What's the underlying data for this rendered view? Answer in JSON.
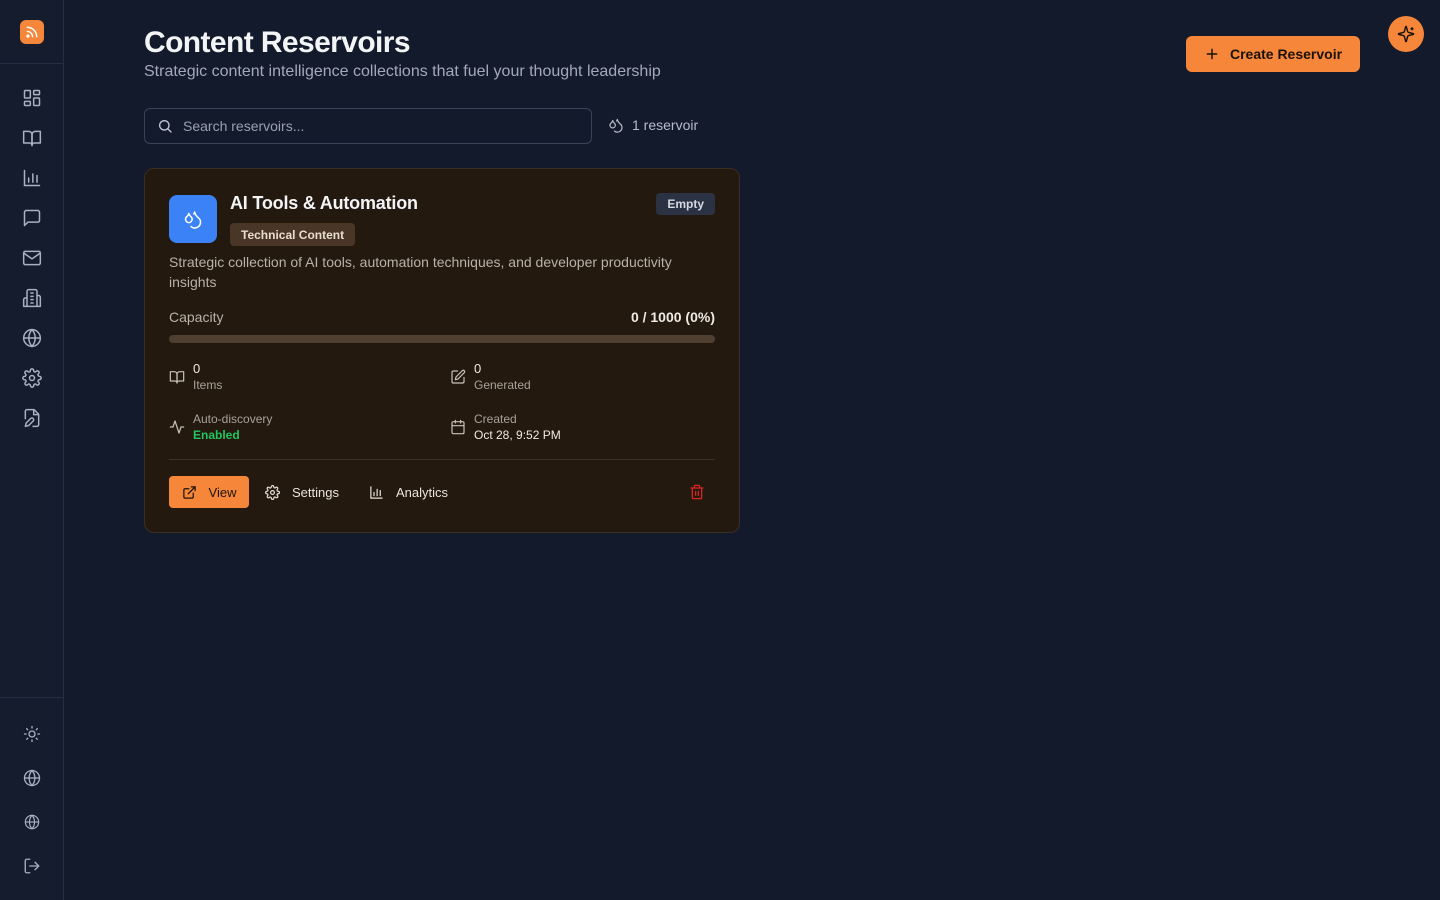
{
  "page": {
    "title": "Content Reservoirs",
    "subtitle": "Strategic content intelligence collections that fuel your thought leadership"
  },
  "actions": {
    "create_label": "Create Reservoir"
  },
  "search": {
    "placeholder": "Search reservoirs..."
  },
  "count_label": "1 reservoir",
  "sidebar": {
    "top_icons": [
      "dashboard-icon",
      "book-open-icon",
      "bar-chart-icon",
      "message-square-icon",
      "mail-icon",
      "building-icon",
      "globe-icon",
      "settings-icon",
      "file-edit-icon"
    ],
    "bottom_icons": [
      "sun-icon",
      "globe-icon",
      "globe-icon",
      "logout-icon"
    ]
  },
  "reservoir": {
    "title": "AI Tools & Automation",
    "category": "Technical Content",
    "status": "Empty",
    "description": "Strategic collection of AI tools, automation techniques, and developer productivity insights",
    "capacity_label": "Capacity",
    "capacity_value": "0 / 1000 (0%)",
    "capacity_fraction": 0,
    "items_value": "0",
    "items_label": "Items",
    "generated_value": "0",
    "generated_label": "Generated",
    "autodiscovery_label": "Auto-discovery",
    "autodiscovery_value": "Enabled",
    "created_label": "Created",
    "created_value": "Oct 28, 9:52 PM",
    "view_label": "View",
    "settings_label": "Settings",
    "analytics_label": "Analytics"
  },
  "colors": {
    "accent": "#f5863a",
    "background": "#131a2b",
    "card": "#23190f",
    "icon_blue": "#3b82f6",
    "enabled_green": "#22c55e",
    "delete_red": "#dc2626"
  }
}
